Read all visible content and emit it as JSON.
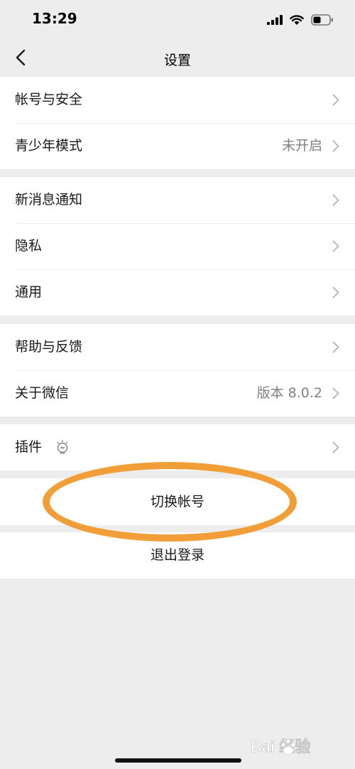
{
  "status_bar": {
    "time": "13:29"
  },
  "nav": {
    "title": "设置"
  },
  "groups": {
    "account": [
      {
        "label": "帐号与安全",
        "value": ""
      },
      {
        "label": "青少年模式",
        "value": "未开启"
      }
    ],
    "notifications": [
      {
        "label": "新消息通知"
      },
      {
        "label": "隐私"
      },
      {
        "label": "通用"
      }
    ],
    "help": [
      {
        "label": "帮助与反馈",
        "value": ""
      },
      {
        "label": "关于微信",
        "value": "版本 8.0.2"
      }
    ],
    "plugins": [
      {
        "label": "插件"
      }
    ]
  },
  "actions": {
    "switch_account": "切换帐号",
    "logout": "退出登录"
  },
  "watermark": {
    "text": "Bai 经验"
  },
  "colors": {
    "background": "#ededed",
    "cell": "#ffffff",
    "highlight": "#f19e38",
    "secondary_text": "#808080"
  }
}
